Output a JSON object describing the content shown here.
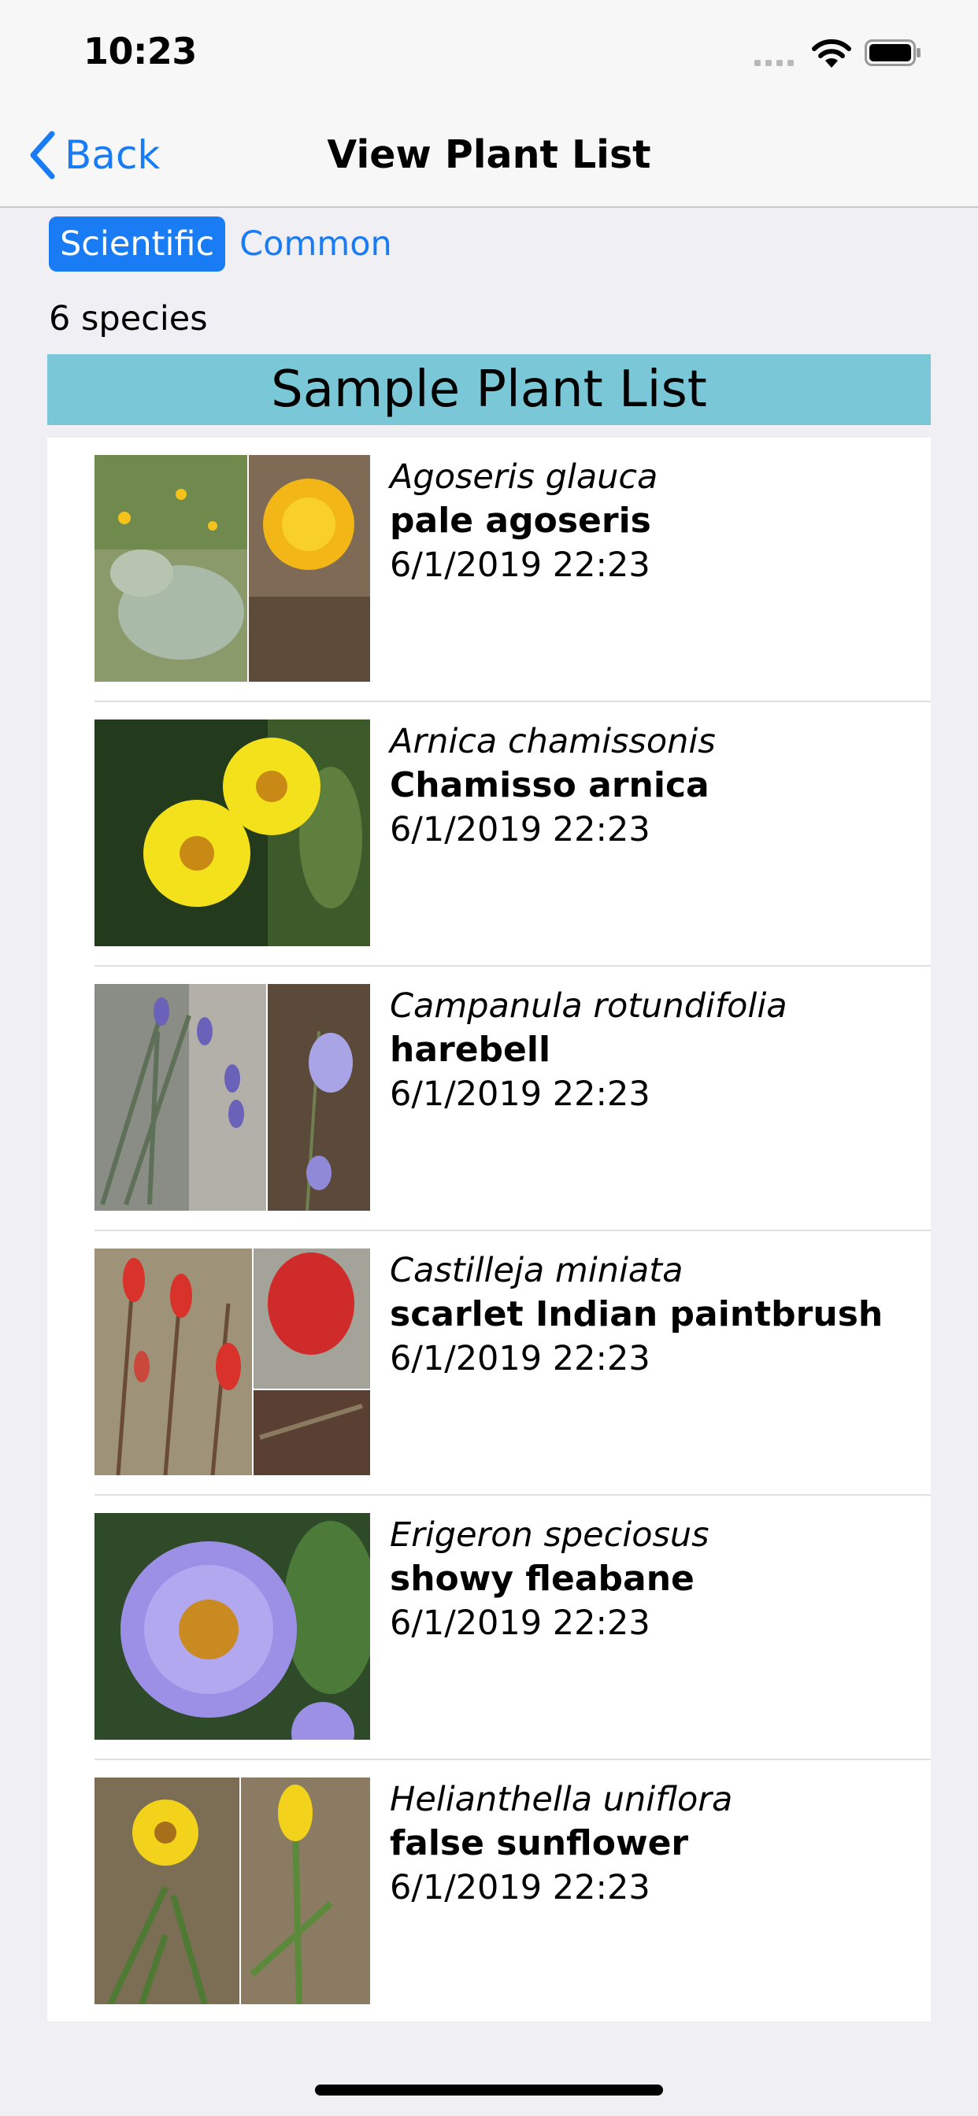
{
  "status": {
    "time": "10:23"
  },
  "nav": {
    "back_label": "Back",
    "title": "View Plant List"
  },
  "segment": {
    "scientific": "Scientific",
    "common": "Common",
    "selected": "Scientific"
  },
  "species_count": "6 species",
  "list_title": "Sample Plant List",
  "plants": [
    {
      "scientific": "Agoseris glauca",
      "common": "pale agoseris",
      "date": "6/1/2019 22:23"
    },
    {
      "scientific": "Arnica chamissonis",
      "common": "Chamisso arnica",
      "date": "6/1/2019 22:23"
    },
    {
      "scientific": "Campanula rotundifolia",
      "common": "harebell",
      "date": "6/1/2019 22:23"
    },
    {
      "scientific": "Castilleja miniata",
      "common": "scarlet Indian paintbrush",
      "date": "6/1/2019 22:23"
    },
    {
      "scientific": "Erigeron speciosus",
      "common": "showy fleabane",
      "date": "6/1/2019 22:23"
    },
    {
      "scientific": "Helianthella uniflora",
      "common": "false sunflower",
      "date": "6/1/2019 22:23"
    }
  ],
  "colors": {
    "accent": "#1a7cf5",
    "header_bg": "#79c7d7"
  }
}
